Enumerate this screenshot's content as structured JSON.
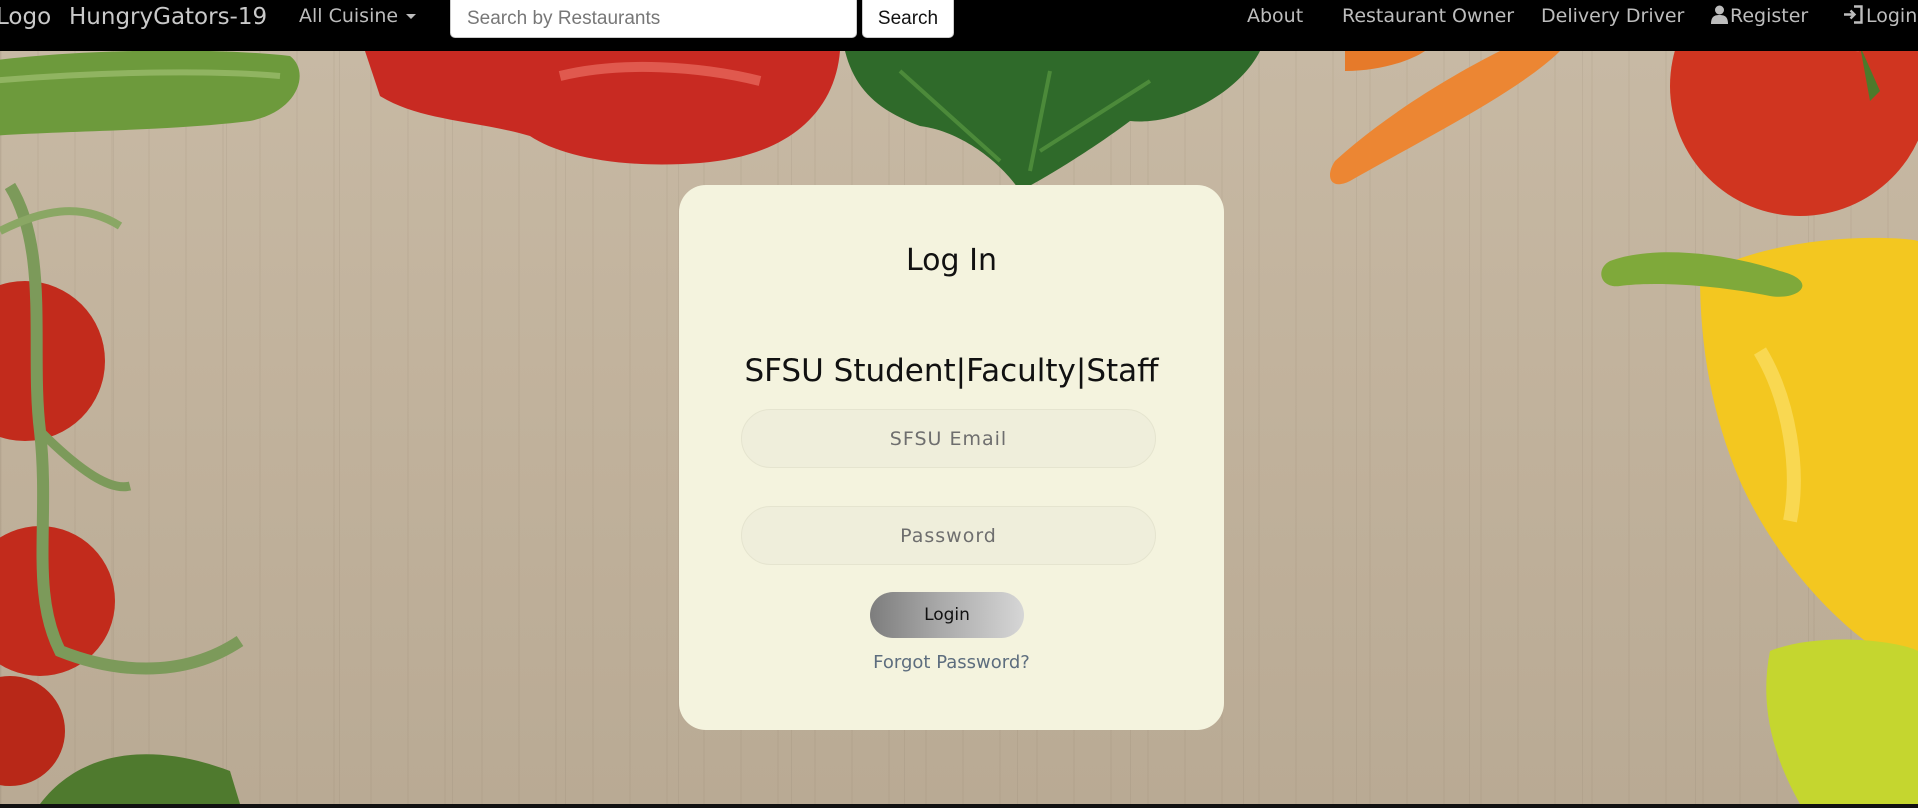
{
  "navbar": {
    "logo": "Logo",
    "brand": "HungryGators-19",
    "cuisine_dropdown": "All Cuisine",
    "search_placeholder": "Search by Restaurants",
    "search_button": "Search",
    "links": {
      "about": "About",
      "restaurant_owner": "Restaurant Owner",
      "delivery_driver": "Delivery Driver",
      "register": "Register",
      "login": "Login"
    },
    "icons": {
      "register": "user-icon",
      "login": "sign-in-icon"
    }
  },
  "login_card": {
    "title": "Log In",
    "subtitle": "SFSU Student|Faculty|Staff",
    "email_placeholder": "SFSU Email",
    "password_placeholder": "Password",
    "login_button": "Login",
    "forgot_password": "Forgot Password?"
  },
  "colors": {
    "navbar_bg": "#000000",
    "card_bg": "#f4f3de",
    "forgot_link": "#5d6d7e"
  }
}
